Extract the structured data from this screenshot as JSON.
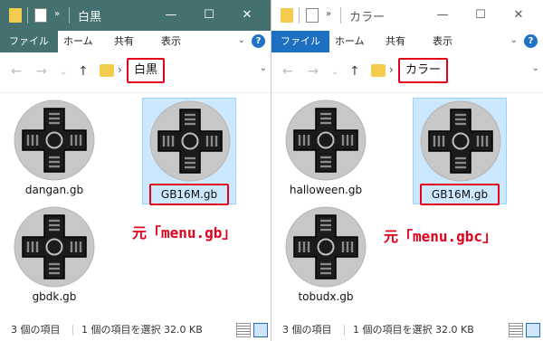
{
  "left": {
    "title": "白黒",
    "ribbon": {
      "file": "ファイル",
      "home": "ホーム",
      "share": "共有",
      "view": "表示"
    },
    "crumb": "白黒",
    "files": [
      "dangan.gb",
      "GB16M.gb",
      "gbdk.gb"
    ],
    "note": "元「menu.gb」",
    "status": {
      "count": "3 個の項目",
      "selection": "1 個の項目を選択 32.0 KB"
    }
  },
  "right": {
    "title": "カラー",
    "ribbon": {
      "file": "ファイル",
      "home": "ホーム",
      "share": "共有",
      "view": "表示"
    },
    "crumb": "カラー",
    "files": [
      "halloween.gb",
      "GB16M.gb",
      "tobudx.gb"
    ],
    "note": "元「menu.gbc」",
    "status": {
      "count": "3 個の項目",
      "selection": "1 個の項目を選択 32.0 KB"
    }
  },
  "icons": {
    "minimize": "minimize-icon",
    "maximize": "maximize-icon",
    "close": "close-icon",
    "back": "back-arrow-icon",
    "forward": "forward-arrow-icon",
    "up": "up-arrow-icon",
    "help": "help-icon",
    "file_icon": "gameboy-dpad-disc-icon"
  },
  "colors": {
    "left_titlebar": "#44706f",
    "right_file_tab": "#1c6fc1",
    "annotation_red": "#e2001a",
    "selection": "#cce8ff"
  }
}
